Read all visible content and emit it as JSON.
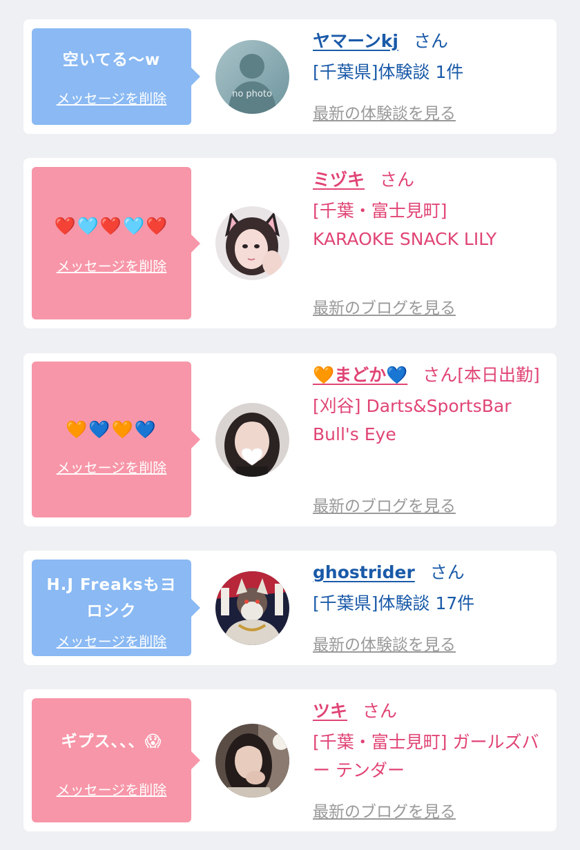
{
  "cards": [
    {
      "message": "空いてる〜w",
      "delete_label": "メッセージを削除",
      "name": "ヤマーンkj",
      "san": "さん",
      "detail": "[千葉県]体験談 1件",
      "more": "最新の体験談を見る",
      "theme": "blue",
      "avatar": "no-photo",
      "avatar_text": "no photo"
    },
    {
      "message": "❤️🩵❤️🩵❤️",
      "delete_label": "メッセージを削除",
      "name": "ミヅキ",
      "san": "さん",
      "detail": "[千葉・富士見町] KARAOKE SNACK LILY",
      "more": "最新のブログを見る",
      "theme": "pink",
      "avatar": "girl-cat-ears"
    },
    {
      "message": "🧡💙🧡💙",
      "delete_label": "メッセージを削除",
      "name": "🧡まどか💙",
      "san": "さん[本日出勤]",
      "detail": "[刈谷] Darts&SportsBar Bull's Eye",
      "more": "最新のブログを見る",
      "theme": "pink",
      "avatar": "girl-heart-face"
    },
    {
      "message": "H.J Freaksもヨロシク",
      "delete_label": "メッセージを削除",
      "name": "ghostrider",
      "san": "さん",
      "detail": "[千葉県]体験談 17件",
      "more": "最新の体験談を見る",
      "theme": "blue",
      "avatar": "illustration"
    },
    {
      "message": "ギプス、、、😱",
      "delete_label": "メッセージを削除",
      "name": "ツキ",
      "san": "さん",
      "detail": "[千葉・富士見町] ガールズバー テンダー",
      "more": "最新のブログを見る",
      "theme": "pink",
      "avatar": "girl-dark"
    }
  ],
  "colors": {
    "background": "#eef0f3",
    "blue_bubble": "#8ab9f3",
    "pink_bubble": "#f796a8",
    "blue_text": "#1a5aa8",
    "pink_text": "#e04474",
    "link_gray": "#999999"
  }
}
